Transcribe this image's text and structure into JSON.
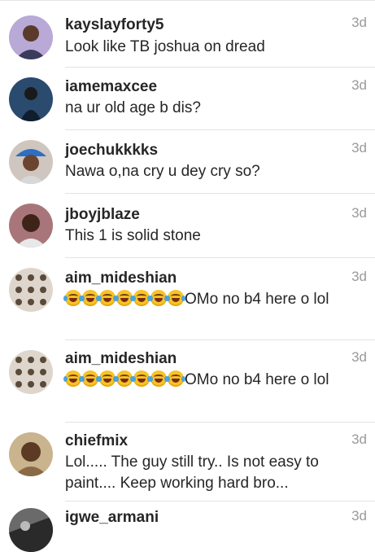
{
  "comments": [
    {
      "username": "kayslayforty5",
      "time": "3d",
      "text": "Look like TB joshua on dread"
    },
    {
      "username": "iamemaxcee",
      "time": "3d",
      "text": "na ur old age b dis?"
    },
    {
      "username": "joechukkkks",
      "time": "3d",
      "text": "Nawa o,na cry u dey cry so?"
    },
    {
      "username": "jboyjblaze",
      "time": "3d",
      "text": "This 1 is solid stone"
    },
    {
      "username": "aim_mideshian",
      "time": "3d",
      "emoji": "face-with-tears-of-joy",
      "emoji_count": 7,
      "text": "OMo no b4 here o lol"
    },
    {
      "username": "aim_mideshian",
      "time": "3d",
      "emoji": "face-with-tears-of-joy",
      "emoji_count": 7,
      "text": "OMo no b4 here o lol"
    },
    {
      "username": "chiefmix",
      "time": "3d",
      "text": "Lol..... The guy still try.. Is not easy to paint.... Keep working hard bro..."
    },
    {
      "username": "igwe_armani",
      "time": "3d",
      "text": ""
    }
  ]
}
